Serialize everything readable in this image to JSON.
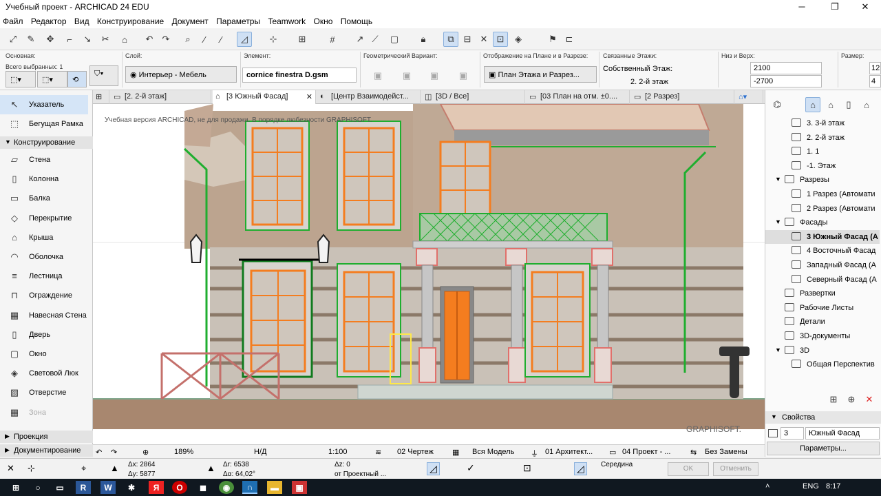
{
  "window": {
    "title": "Учебный проект - ARCHICAD 24 EDU",
    "minimize": "─",
    "maximize": "❐",
    "close": "✕"
  },
  "menu": [
    "Файл",
    "Редактор",
    "Вид",
    "Конструирование",
    "Документ",
    "Параметры",
    "Teamwork",
    "Окно",
    "Помощь"
  ],
  "info": {
    "osnovnaya_label": "Основная:",
    "vsego_label": "Всего выбранных: 1",
    "layer_label": "Слой:",
    "layer_value": "Интерьер - Мебель",
    "element_label": "Элемент:",
    "element_value": "cornice finestra D.gsm",
    "geom_label": "Геометрический Вариант:",
    "display_label": "Отображение на Плане и в Разрезе:",
    "display_value": "План Этажа и Разрез...",
    "linked_label": "Связанные Этажи:",
    "own_floor_label": "Собственный Этаж:",
    "own_floor_value": "2. 2-й этаж",
    "bottom_top_label": "Низ и Верх:",
    "top_value": "2100",
    "bottom_value": "-2700",
    "size_label": "Размер:",
    "size_a": "12",
    "size_b": "4"
  },
  "toolbox": {
    "tools_top": [
      {
        "label": "Указатель",
        "icon": "pointer-icon"
      },
      {
        "label": "Бегущая Рамка",
        "icon": "marquee-icon"
      }
    ],
    "section_design": "Конструирование",
    "tools": [
      {
        "label": "Стена",
        "icon": "wall-icon"
      },
      {
        "label": "Колонна",
        "icon": "column-icon"
      },
      {
        "label": "Балка",
        "icon": "beam-icon"
      },
      {
        "label": "Перекрытие",
        "icon": "slab-icon"
      },
      {
        "label": "Крыша",
        "icon": "roof-icon"
      },
      {
        "label": "Оболочка",
        "icon": "shell-icon"
      },
      {
        "label": "Лестница",
        "icon": "stair-icon"
      },
      {
        "label": "Ограждение",
        "icon": "railing-icon"
      },
      {
        "label": "Навесная Стена",
        "icon": "curtain-wall-icon"
      },
      {
        "label": "Дверь",
        "icon": "door-icon"
      },
      {
        "label": "Окно",
        "icon": "window-icon"
      },
      {
        "label": "Световой Люк",
        "icon": "skylight-icon"
      },
      {
        "label": "Отверстие",
        "icon": "opening-icon"
      },
      {
        "label": "Зона",
        "icon": "zone-icon"
      }
    ],
    "section_projection": "Проекция",
    "section_doc": "Документирование"
  },
  "tabs": [
    {
      "label": "[2. 2-й этаж]",
      "icon": "floor-plan-icon"
    },
    {
      "label": "[3 Южный Фасад]",
      "icon": "elevation-icon"
    },
    {
      "label": "[Центр Взаимодейст...",
      "icon": "issue-icon"
    },
    {
      "label": "[3D / Все]",
      "icon": "3d-icon"
    },
    {
      "label": "[03 План на отм. ±0....",
      "icon": "layout-icon"
    },
    {
      "label": "[2 Разрез]",
      "icon": "section-icon"
    }
  ],
  "tab_close": "✕",
  "watermark": "Учебная версия ARCHICAD, не для продажи. В порядке любезности GRAPHISOFT.",
  "brand": "GRAPHISOFT.",
  "navigator": {
    "items": [
      {
        "label": "3. 3-й этаж",
        "indent": 2
      },
      {
        "label": "2. 2-й этаж",
        "indent": 2
      },
      {
        "label": "1. 1",
        "indent": 2
      },
      {
        "label": "-1. Этаж",
        "indent": 2
      },
      {
        "label": "Разрезы",
        "indent": 1,
        "expanded": true
      },
      {
        "label": "1 Разрез (Автомати",
        "indent": 2
      },
      {
        "label": "2 Разрез (Автомати",
        "indent": 2
      },
      {
        "label": "Фасады",
        "indent": 1,
        "expanded": true
      },
      {
        "label": "3 Южный Фасад (А",
        "indent": 2,
        "selected": true
      },
      {
        "label": "4 Восточный Фасад",
        "indent": 2
      },
      {
        "label": "Западный Фасад (А",
        "indent": 2
      },
      {
        "label": "Северный Фасад (А",
        "indent": 2
      },
      {
        "label": "Развертки",
        "indent": 1
      },
      {
        "label": "Рабочие Листы",
        "indent": 1
      },
      {
        "label": "Детали",
        "indent": 1
      },
      {
        "label": "3D-документы",
        "indent": 1
      },
      {
        "label": "3D",
        "indent": 1,
        "expanded": true
      },
      {
        "label": "Общая Перспектив",
        "indent": 2
      }
    ],
    "properties_title": "Свойства",
    "prop_id": "3",
    "prop_name": "Южный Фасад",
    "params_button": "Параметры..."
  },
  "status": {
    "zoom": "189%",
    "nd": "Н/Д",
    "scale": "1:100",
    "layer_combo": "02 Чертеж",
    "model_view": "Вся Модель",
    "pen_set": "01 Архитект...",
    "dim": "04 Проект - ...",
    "override": "Без Замены"
  },
  "coords": {
    "dx": "Δx: 2864",
    "dy": "Δy: 5877",
    "dr": "Δr: 6538",
    "da": "Δα: 64,02°",
    "dz": "Δz: 0",
    "ref": "от Проектный ...",
    "snap": "Середина",
    "ok": "OK",
    "cancel": "Отменить"
  },
  "taskbar": {
    "lang": "ENG",
    "time": "8:17"
  },
  "colors": {
    "accent": "#cfe0f4",
    "selection": "#1fae2f",
    "window_frame": "#f47d1f"
  }
}
